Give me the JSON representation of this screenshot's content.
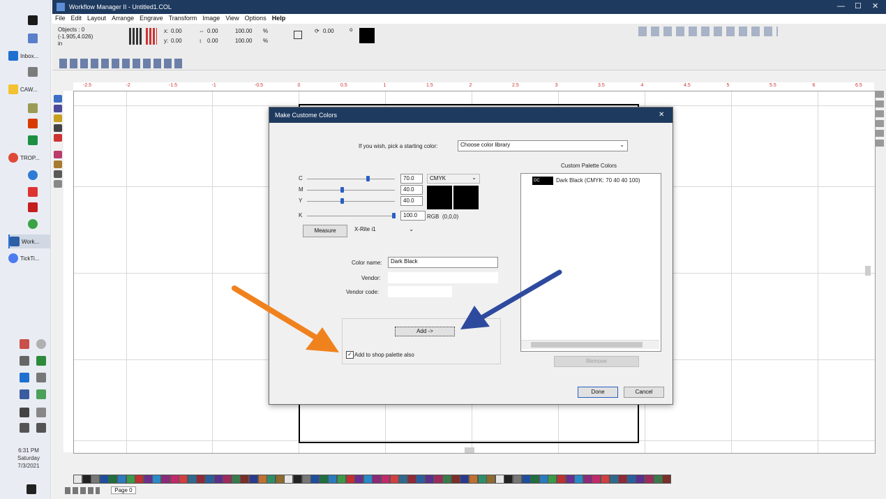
{
  "taskbar": {
    "apps": [
      {
        "label": "Inbox..."
      },
      {
        "label": "CAW..."
      },
      {
        "label": "TROP..."
      },
      {
        "label": "Work..."
      },
      {
        "label": "TickTi..."
      }
    ],
    "clock": {
      "time": "6:31 PM",
      "day": "Saturday",
      "date": "7/3/2021"
    }
  },
  "window": {
    "title": "Workflow Manager II - Untitled1.COL",
    "menu": [
      "File",
      "Edit",
      "Layout",
      "Arrange",
      "Engrave",
      "Transform",
      "Image",
      "View",
      "Options",
      "Help"
    ],
    "toolbar": {
      "objects_label": "Objects : 0",
      "coords": "(-1.905,4.026)",
      "unit": "in",
      "x_label": "x:",
      "x_value": "0.00",
      "y_label": "y:",
      "y_value": "0.00",
      "w_value": "0.00",
      "h_value": "0.00",
      "sx_value": "100.00",
      "sy_value": "100.00",
      "percent": "%",
      "rotate_value": "0.00",
      "angle_unit": "o"
    },
    "ruler_ticks": [
      "-2.5",
      "-2",
      "-1.5",
      "-1",
      "-0.5",
      "0",
      "0.5",
      "1",
      "1.5",
      "2",
      "2.5",
      "3",
      "3.5",
      "4",
      "4.5",
      "5",
      "5.5",
      "6",
      "6.5"
    ],
    "page_label": "Page 0"
  },
  "dialog": {
    "title": "Make Custome Colors",
    "starting_color_label": "If you wish, pick a starting color:",
    "starting_color_value": "Choose color library",
    "channels": [
      {
        "name": "C",
        "value": "70.0",
        "level": 0.7
      },
      {
        "name": "M",
        "value": "40.0",
        "level": 0.4
      },
      {
        "name": "Y",
        "value": "40.0",
        "level": 0.4
      },
      {
        "name": "K",
        "value": "100.0",
        "level": 1.0
      }
    ],
    "color_model": "CMYK",
    "rgb_label": "RGB",
    "rgb_value": "(0,0,0)",
    "measure_button": "Measure",
    "device_value": "X-Rite i1",
    "color_name_label": "Color name:",
    "color_name_value": "Dark Black",
    "vendor_label": "Vendor:",
    "vendor_value": "",
    "vendor_code_label": "Vendor code:",
    "vendor_code_value": "",
    "add_button": "Add ->",
    "add_to_shop_label": "Add to shop palette also",
    "add_to_shop_checked": true,
    "custom_palette_header": "Custom Palette Colors",
    "palette_items": [
      {
        "swatch_text": "DC",
        "label": "Dark Black (CMYK: 70 40 40 100)"
      }
    ],
    "remove_button": "Remove",
    "done_button": "Done",
    "cancel_button": "Cancel",
    "close_glyph": "✕"
  },
  "annotations": {
    "orange_arrow_color": "#f0821e",
    "blue_arrow_color": "#2e4a9e"
  },
  "colors": {
    "title_bar": "#1e3a5f",
    "accent": "#2a5fc7"
  }
}
